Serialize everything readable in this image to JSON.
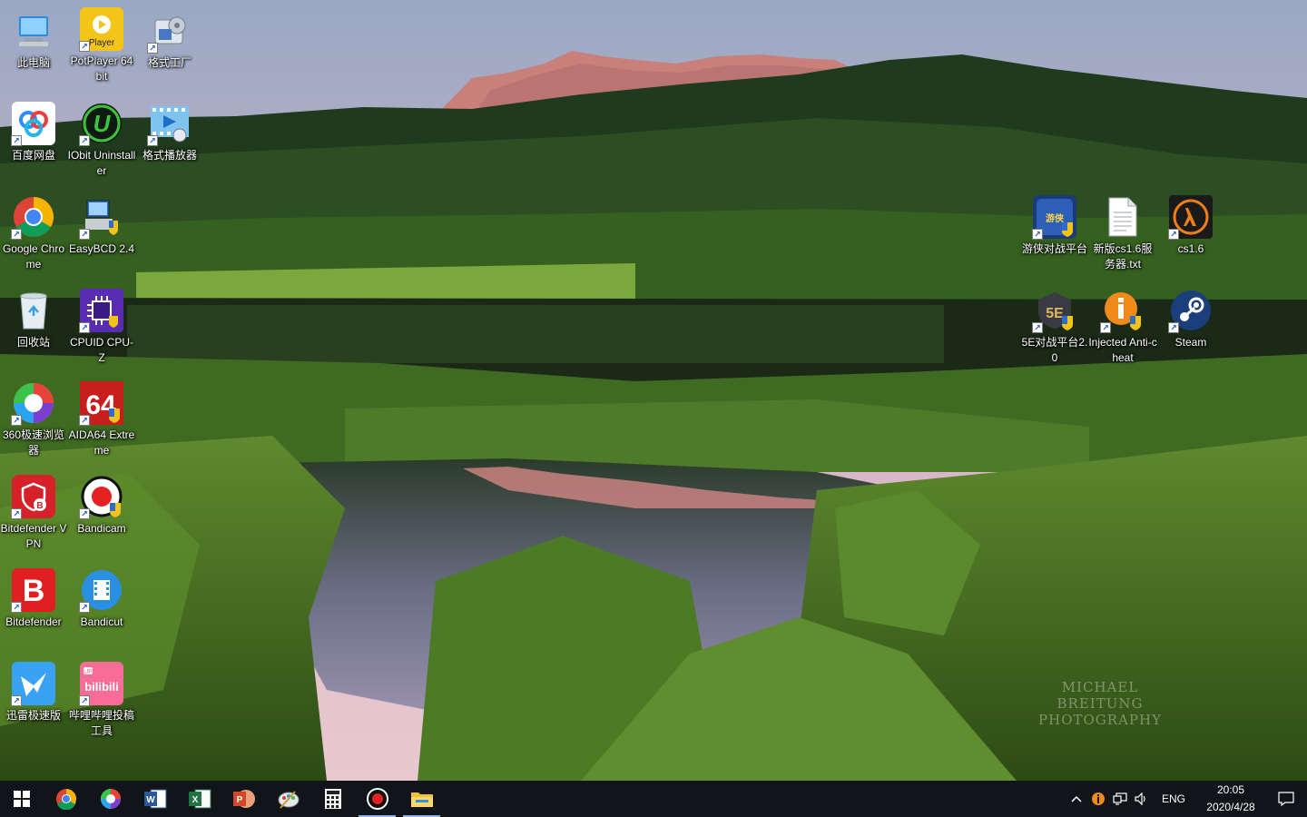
{
  "desktop": {
    "watermark_line1": "MICHAEL BREITUNG",
    "watermark_line2": "PHOTOGRAPHY",
    "icons": [
      {
        "id": "this-pc",
        "label": "此电脑",
        "icon": "computer-icon"
      },
      {
        "id": "potplayer",
        "label": "PotPlayer 64 bit",
        "icon": "potplayer-icon"
      },
      {
        "id": "format-factory",
        "label": "格式工厂",
        "icon": "format-factory-icon"
      },
      {
        "id": "baidu-netdisk",
        "label": "百度网盘",
        "icon": "baidu-netdisk-icon"
      },
      {
        "id": "iobit-uninstaller",
        "label": "IObit Uninstaller",
        "icon": "iobit-uninstaller-icon"
      },
      {
        "id": "format-player",
        "label": "格式播放器",
        "icon": "format-player-icon"
      },
      {
        "id": "google-chrome",
        "label": "Google Chrome",
        "icon": "chrome-icon"
      },
      {
        "id": "easybcd",
        "label": "EasyBCD 2.4",
        "icon": "easybcd-icon"
      },
      {
        "id": "recycle-bin",
        "label": "回收站",
        "icon": "recycle-bin-icon"
      },
      {
        "id": "cpuz",
        "label": "CPUID CPU-Z",
        "icon": "cpuz-icon"
      },
      {
        "id": "360-browser",
        "label": "360极速浏览器",
        "icon": "360-browser-icon"
      },
      {
        "id": "aida64",
        "label": "AIDA64 Extreme",
        "icon": "aida64-icon"
      },
      {
        "id": "bitdefender-vpn",
        "label": "Bitdefender VPN",
        "icon": "bitdefender-vpn-icon"
      },
      {
        "id": "bandicam",
        "label": "Bandicam",
        "icon": "bandicam-icon"
      },
      {
        "id": "bitdefender",
        "label": "Bitdefender",
        "icon": "bitdefender-icon"
      },
      {
        "id": "bandicut",
        "label": "Bandicut",
        "icon": "bandicut-icon"
      },
      {
        "id": "xunlei",
        "label": "迅雷极速版",
        "icon": "xunlei-icon"
      },
      {
        "id": "bilibili-upload",
        "label": "哔哩哔哩投稿工具",
        "icon": "bilibili-icon"
      },
      {
        "id": "youxia",
        "label": "游侠对战平台",
        "icon": "youxia-icon"
      },
      {
        "id": "cs-server-txt",
        "label": "新版cs1.6服务器.txt",
        "icon": "text-file-icon"
      },
      {
        "id": "cs16",
        "label": "cs1.6",
        "icon": "half-life-icon"
      },
      {
        "id": "5e-platform",
        "label": "5E对战平台2.0",
        "icon": "5e-icon"
      },
      {
        "id": "injected-anticheat",
        "label": "Injected Anti-cheat",
        "icon": "injected-icon"
      },
      {
        "id": "steam",
        "label": "Steam",
        "icon": "steam-icon"
      }
    ]
  },
  "taskbar": {
    "pinned": [
      {
        "id": "start",
        "icon": "windows-start-icon"
      },
      {
        "id": "chrome",
        "icon": "chrome-icon"
      },
      {
        "id": "360",
        "icon": "360-browser-icon"
      },
      {
        "id": "word",
        "icon": "word-icon"
      },
      {
        "id": "excel",
        "icon": "excel-icon"
      },
      {
        "id": "powerpoint",
        "icon": "powerpoint-icon"
      },
      {
        "id": "paint",
        "icon": "paint-icon"
      },
      {
        "id": "calculator",
        "icon": "calculator-icon"
      },
      {
        "id": "bandicam",
        "icon": "bandicam-record-icon"
      },
      {
        "id": "explorer",
        "icon": "file-explorer-icon"
      }
    ],
    "tray": {
      "language": "ENG",
      "time": "20:05",
      "date": "2020/4/28"
    }
  },
  "colors": {
    "taskbar_bg": "#111418",
    "accent_underline": "#8fb3e8"
  }
}
